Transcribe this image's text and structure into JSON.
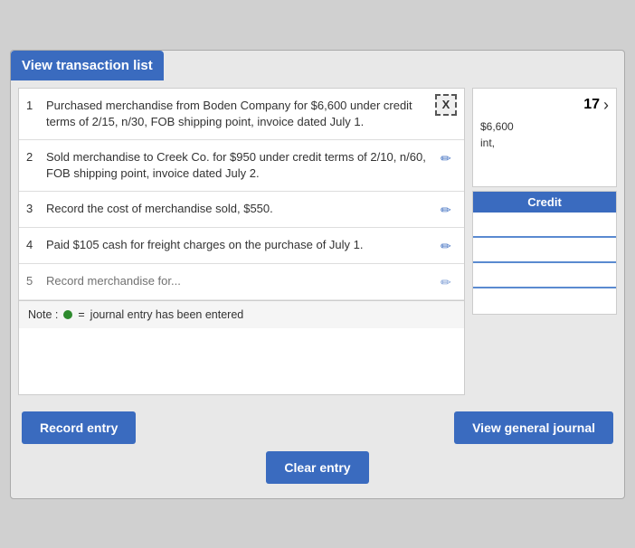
{
  "header": {
    "title": "View transaction list"
  },
  "close_button": "X",
  "transactions": [
    {
      "number": "1",
      "text": "Purchased merchandise from Boden Company for $6,600 under credit terms of 2/15, n/30, FOB shipping point, invoice dated July 1."
    },
    {
      "number": "2",
      "text": "Sold merchandise to Creek Co. for $950 under credit terms of 2/10, n/60, FOB shipping point, invoice dated July 2."
    },
    {
      "number": "3",
      "text": "Record the cost of merchandise sold, $550."
    },
    {
      "number": "4",
      "text": "Paid $105 cash for freight charges on the purchase of July 1."
    },
    {
      "number": "5",
      "text": "Record merchandise for..."
    }
  ],
  "note": {
    "label": "Note :",
    "equal": "=",
    "description": "journal entry has been entered"
  },
  "journal_panel": {
    "page_number": "17",
    "content_line1": "$6,600",
    "content_line2": "int,"
  },
  "debit_credit": {
    "credit_label": "Credit"
  },
  "buttons": {
    "record_entry": "Record entry",
    "clear_entry": "Clear entry",
    "view_general_journal": "View general journal"
  }
}
